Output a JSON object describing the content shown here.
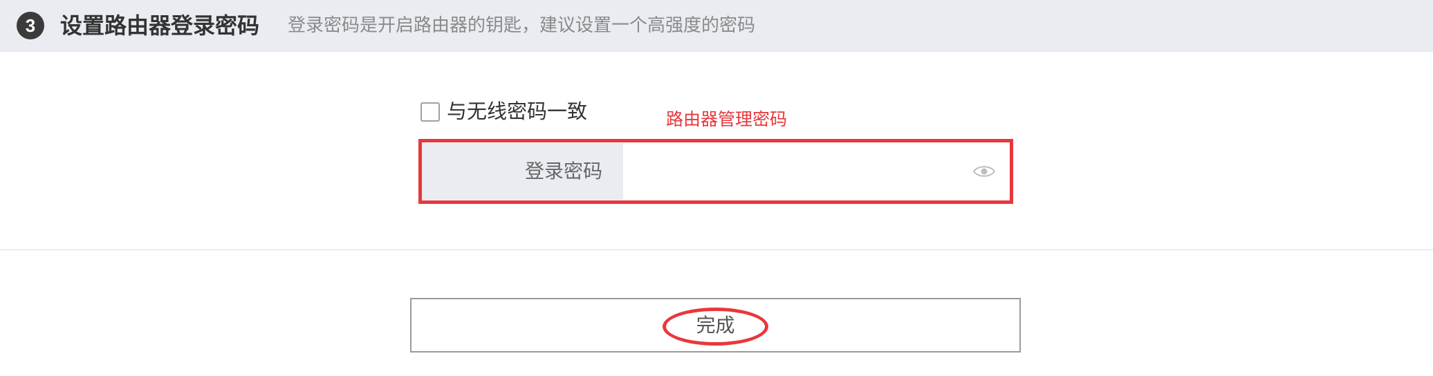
{
  "header": {
    "step": "3",
    "title": "设置路由器登录密码",
    "subtitle": "登录密码是开启路由器的钥匙，建议设置一个高强度的密码"
  },
  "form": {
    "same_as_wireless_label": "与无线密码一致",
    "same_as_wireless_checked": false,
    "password_label": "登录密码",
    "password_value": ""
  },
  "annotation": {
    "text": "路由器管理密码"
  },
  "footer": {
    "finish_label": "完成"
  },
  "icons": {
    "step": "step-number-icon",
    "visibility": "eye-icon"
  },
  "colors": {
    "header_bg": "#e9ecf1",
    "annotation": "#e8373b",
    "step_circle": "#3b3b3b",
    "subtitle": "#8a8a8a"
  }
}
